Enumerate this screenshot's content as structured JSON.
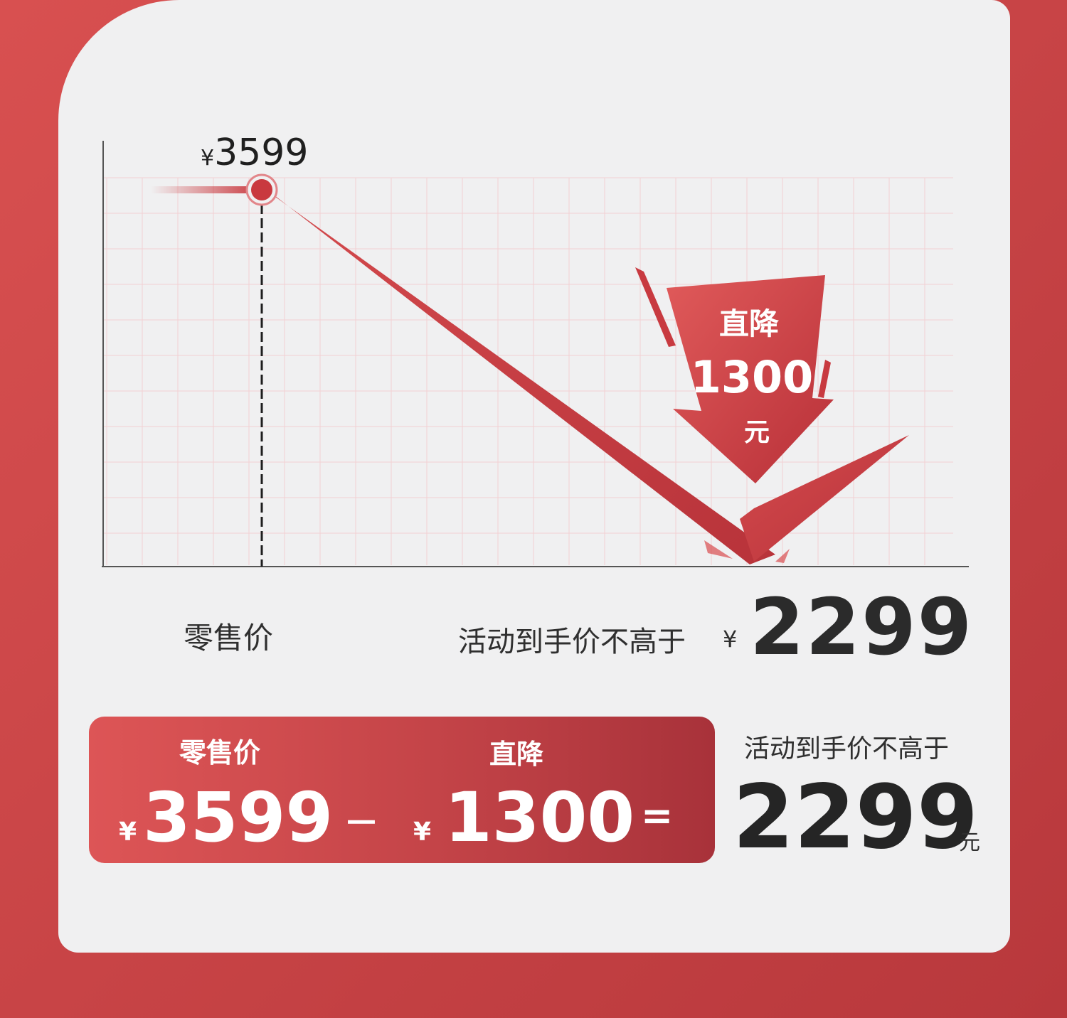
{
  "chart_data": {
    "type": "line",
    "categories": [
      "零售价",
      "活动到手价不高于"
    ],
    "values": [
      3599,
      2299
    ],
    "title": "",
    "xlabel": "",
    "ylabel": "",
    "ylim": [
      2299,
      3599
    ],
    "point_label": "¥3599",
    "arrow_text": [
      "直降",
      "1300",
      "元"
    ],
    "colors": {
      "accent": "#c9393f",
      "grid": "#f2d0d2",
      "axis": "#555555"
    }
  },
  "chart_labels": {
    "retail": "零售价",
    "activity": "活动到手价不高于",
    "yen": "¥",
    "final_price": "2299"
  },
  "banner": {
    "retail_label": "零售价",
    "discount_label": "直降",
    "yen": "¥",
    "retail_value": "3599",
    "minus": "－",
    "discount_value": "1300",
    "equals": "="
  },
  "result": {
    "label": "活动到手价不高于",
    "value": "2299",
    "unit": "元"
  },
  "colors": {
    "background": "#c84446",
    "card": "#f0f0f1",
    "banner_start": "#dd5556",
    "banner_end": "#a8323a"
  }
}
